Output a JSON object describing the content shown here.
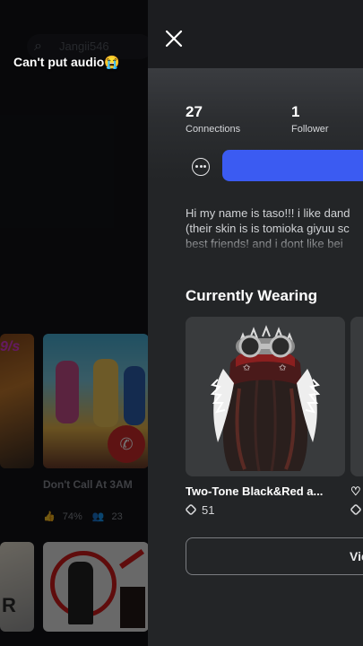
{
  "background_app": {
    "search_icon": "search-icon",
    "search_username": "Jangii546",
    "caption": "Can't put audio😭",
    "tile_a_badge": "9/s",
    "game_title": "Don't Call At 3AM",
    "game_rating": "74%",
    "game_players": "23",
    "tile_c_letters": "R"
  },
  "profile": {
    "close_icon": "close-icon",
    "stats": {
      "connections_count": "27",
      "connections_label": "Connections",
      "followers_count": "1",
      "followers_label": "Follower"
    },
    "more_icon": "more-options-icon",
    "bio": "Hi my name is taso!!! i like dand\n(their skin is is tomioka giyuu sc\nbest friends! and i dont like bei",
    "currently_wearing": {
      "title": "Currently Wearing",
      "items": [
        {
          "name": "Two-Tone Black&Red a...",
          "price": "51",
          "icon": "hair-accessory-thumbnail"
        },
        {
          "name": "♡",
          "price": "",
          "icon": "item-thumbnail"
        }
      ]
    },
    "view_button": "Vie"
  },
  "colors": {
    "primary_button": "#3b5bf2",
    "panel_background": "#232527"
  }
}
